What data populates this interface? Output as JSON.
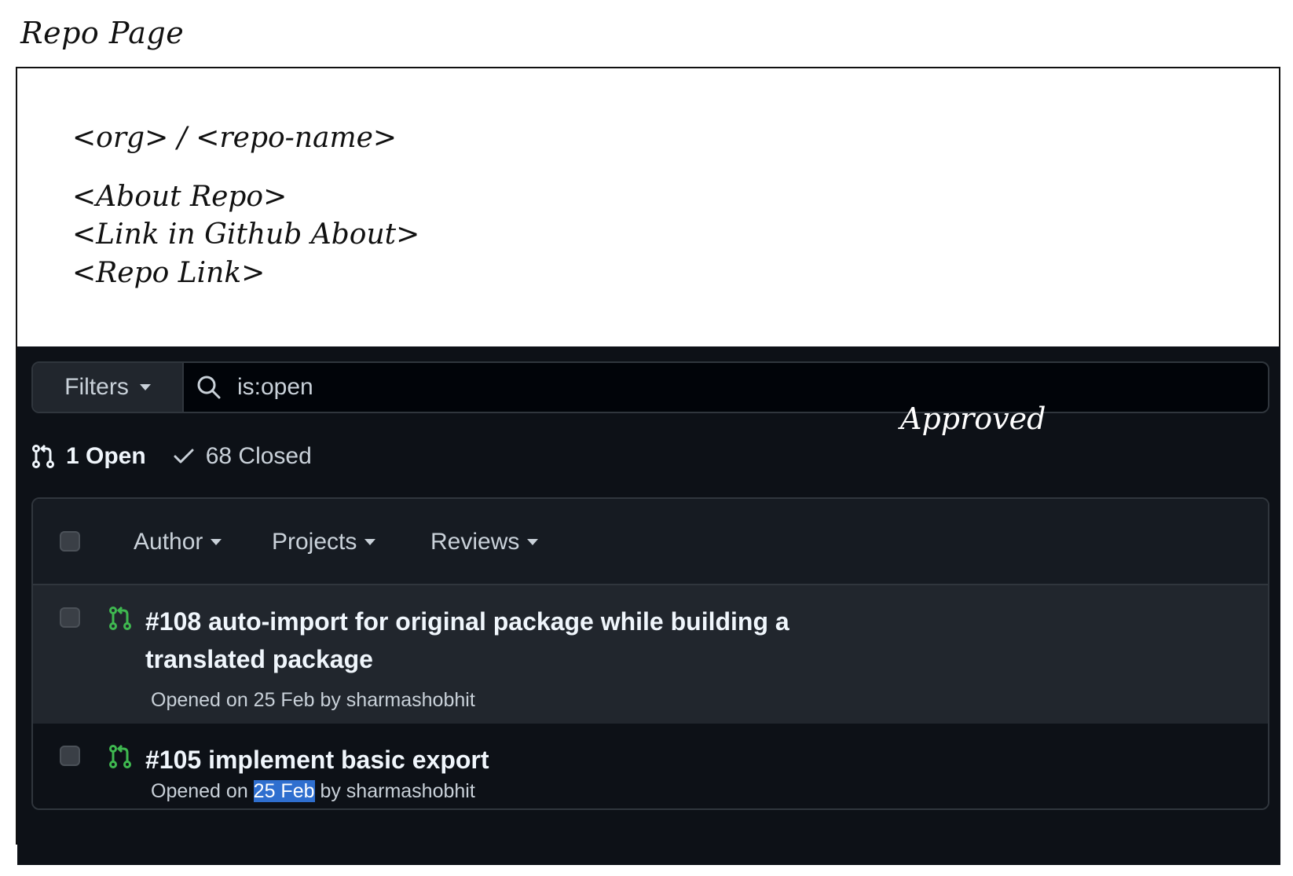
{
  "wireframe": {
    "caption": "Repo Page",
    "repo_title": "<org> / <repo-name>",
    "lines": [
      "<About Repo>",
      "<Link in Github About>",
      "<Repo Link>"
    ],
    "approved_note": "Approved"
  },
  "search": {
    "filters_label": "Filters",
    "query": "is:open"
  },
  "states": {
    "open_label": "1 Open",
    "closed_label": "68 Closed"
  },
  "list_header": {
    "author": "Author",
    "projects": "Projects",
    "reviews": "Reviews"
  },
  "pull_requests": [
    {
      "title": "#108 auto-import for original package while building a translated package",
      "meta_prefix": "Opened on 25 Feb by sharmashobhit",
      "meta_date": "",
      "meta_suffix": ""
    },
    {
      "title": "#105 implement basic export",
      "meta_prefix": "Opened on ",
      "meta_date": "25 Feb",
      "meta_suffix": " by sharmashobhit"
    }
  ],
  "colors": {
    "background_dark": "#0d1117",
    "open_pr_green": "#3fb950",
    "highlight": "#2f6fcf"
  }
}
